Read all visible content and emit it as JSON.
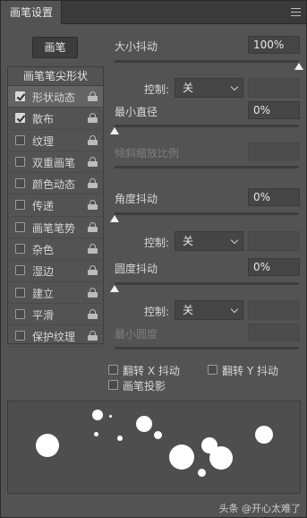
{
  "titlebar": {
    "tab_label": "画笔设置"
  },
  "brush_button": "画笔",
  "tip_shape_label": "画笔笔尖形状",
  "options": [
    {
      "label": "形状动态",
      "checked": true,
      "selected": true,
      "lock_icon": "lock-open-icon"
    },
    {
      "label": "散布",
      "checked": true,
      "selected": false,
      "lock_icon": "lock-open-icon"
    },
    {
      "label": "纹理",
      "checked": false,
      "selected": false,
      "lock_icon": "lock-open-icon"
    },
    {
      "label": "双重画笔",
      "checked": false,
      "selected": false,
      "lock_icon": "lock-open-icon"
    },
    {
      "label": "颜色动态",
      "checked": false,
      "selected": false,
      "lock_icon": "lock-open-icon"
    },
    {
      "label": "传递",
      "checked": false,
      "selected": false,
      "lock_icon": "lock-open-icon"
    },
    {
      "label": "画笔笔势",
      "checked": false,
      "selected": false,
      "lock_icon": "lock-open-icon"
    },
    {
      "label": "杂色",
      "checked": false,
      "selected": false,
      "lock_icon": "lock-open-icon"
    },
    {
      "label": "湿边",
      "checked": false,
      "selected": false,
      "lock_icon": "lock-open-icon"
    },
    {
      "label": "建立",
      "checked": false,
      "selected": false,
      "lock_icon": "lock-open-icon"
    },
    {
      "label": "平滑",
      "checked": false,
      "selected": false,
      "lock_icon": "lock-open-icon"
    },
    {
      "label": "保护纹理",
      "checked": false,
      "selected": false,
      "lock_icon": "lock-open-icon"
    }
  ],
  "size_jitter": {
    "label": "大小抖动",
    "value": "100%",
    "slider_fraction": 1.0
  },
  "size_control": {
    "label": "控制:",
    "selected": "关",
    "value": ""
  },
  "min_diameter": {
    "label": "最小直径",
    "value": "0%",
    "slider_fraction": 0.0
  },
  "tilt_scale": {
    "label": "倾斜缩放比例",
    "value": ""
  },
  "angle_jitter": {
    "label": "角度抖动",
    "value": "0%",
    "slider_fraction": 0.0
  },
  "angle_control": {
    "label": "控制:",
    "selected": "关",
    "value": ""
  },
  "roundness_jitter": {
    "label": "圆度抖动",
    "value": "0%",
    "slider_fraction": 0.0
  },
  "roundness_control": {
    "label": "控制:",
    "selected": "关",
    "value": ""
  },
  "min_roundness": {
    "label": "最小圆度",
    "value": ""
  },
  "flip_x": {
    "label": "翻转 X 抖动",
    "checked": false
  },
  "flip_y": {
    "label": "翻转 Y 抖动",
    "checked": false
  },
  "brush_projection": {
    "label": "画笔投影",
    "checked": false
  },
  "watermark": "头条 @开心太难了",
  "colors": {
    "panel": "#535353",
    "titlebar": "#3a3a3a",
    "field": "#454545",
    "thumb": "#f0f0f0"
  }
}
